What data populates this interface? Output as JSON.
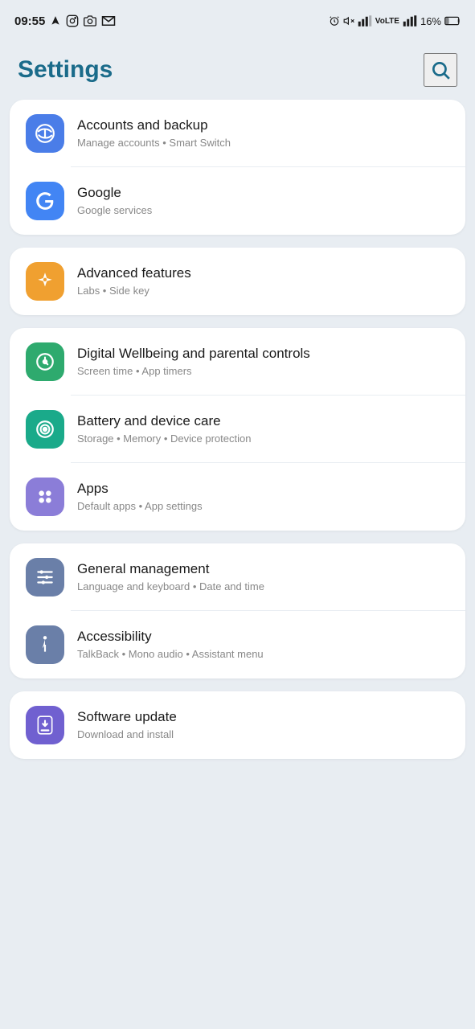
{
  "statusBar": {
    "time": "09:55",
    "icons_left": [
      "navigation-arrow",
      "instagram",
      "camera",
      "gmail"
    ],
    "icons_right": [
      "alarm",
      "mute",
      "signal1",
      "volte-lte",
      "signal2",
      "battery"
    ],
    "battery_text": "16%"
  },
  "header": {
    "title": "Settings",
    "search_label": "Search"
  },
  "groups": [
    {
      "id": "group1",
      "items": [
        {
          "id": "accounts-backup",
          "title": "Accounts and backup",
          "subtitle": "Manage accounts • Smart Switch",
          "icon_color": "blue",
          "icon_type": "sync"
        },
        {
          "id": "google",
          "title": "Google",
          "subtitle": "Google services",
          "icon_color": "google-blue",
          "icon_type": "google"
        }
      ]
    },
    {
      "id": "group2",
      "items": [
        {
          "id": "advanced-features",
          "title": "Advanced features",
          "subtitle": "Labs • Side key",
          "icon_color": "orange",
          "icon_type": "star"
        }
      ]
    },
    {
      "id": "group3",
      "items": [
        {
          "id": "digital-wellbeing",
          "title": "Digital Wellbeing and parental controls",
          "subtitle": "Screen time • App timers",
          "icon_color": "green",
          "icon_type": "leaf"
        },
        {
          "id": "battery-device",
          "title": "Battery and device care",
          "subtitle": "Storage • Memory • Device protection",
          "icon_color": "teal",
          "icon_type": "shield"
        },
        {
          "id": "apps",
          "title": "Apps",
          "subtitle": "Default apps • App settings",
          "icon_color": "lavender",
          "icon_type": "apps"
        }
      ]
    },
    {
      "id": "group4",
      "items": [
        {
          "id": "general-management",
          "title": "General management",
          "subtitle": "Language and keyboard • Date and time",
          "icon_color": "slate",
          "icon_type": "sliders"
        },
        {
          "id": "accessibility",
          "title": "Accessibility",
          "subtitle": "TalkBack • Mono audio • Assistant menu",
          "icon_color": "slate",
          "icon_type": "accessibility"
        }
      ]
    },
    {
      "id": "group5",
      "items": [
        {
          "id": "software-update",
          "title": "Software update",
          "subtitle": "Download and install",
          "icon_color": "purple",
          "icon_type": "update"
        }
      ]
    }
  ]
}
